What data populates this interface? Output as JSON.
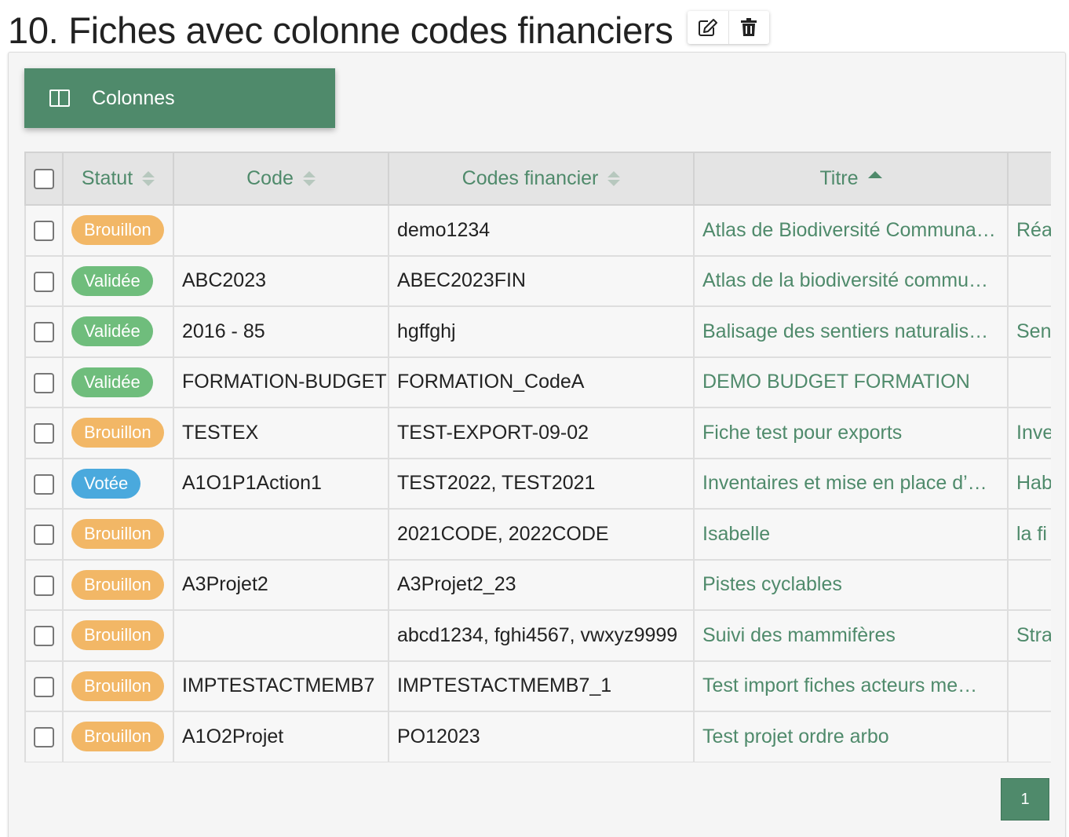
{
  "page": {
    "title": "10. Fiches avec colonne codes financiers",
    "actions": [
      {
        "name": "edit",
        "icon": "edit-icon"
      },
      {
        "name": "delete",
        "icon": "trash-icon"
      }
    ]
  },
  "toolbar": {
    "columns_label": "Colonnes",
    "columns_icon": "columns-icon"
  },
  "table": {
    "headers": {
      "statut": "Statut",
      "code": "Code",
      "codes_financier": "Codes financier",
      "titre": "Titre"
    },
    "sort": {
      "column": "Titre",
      "direction": "asc"
    },
    "rows": [
      {
        "statut": "Brouillon",
        "code": "",
        "codes_financier": "demo1234",
        "titre": "Atlas de Biodiversité Communa…",
        "extra": "Réa"
      },
      {
        "statut": "Validée",
        "code": "ABC2023",
        "codes_financier": "ABEC2023FIN",
        "titre": "Atlas de la biodiversité commu…",
        "extra": ""
      },
      {
        "statut": "Validée",
        "code": "2016 - 85",
        "codes_financier": "hgffghj",
        "titre": "Balisage des sentiers naturalis…",
        "extra": "Sen"
      },
      {
        "statut": "Validée",
        "code": "FORMATION-BUDGET",
        "codes_financier": "FORMATION_CodeA",
        "titre": "DEMO BUDGET FORMATION",
        "extra": ""
      },
      {
        "statut": "Brouillon",
        "code": "TESTEX",
        "codes_financier": "TEST-EXPORT-09-02",
        "titre": "Fiche test pour exports",
        "extra": "Inve"
      },
      {
        "statut": "Votée",
        "code": "A1O1P1Action1",
        "codes_financier": "TEST2022, TEST2021",
        "titre": "Inventaires et mise en place d’…",
        "extra": "Hab"
      },
      {
        "statut": "Brouillon",
        "code": "",
        "codes_financier": "2021CODE, 2022CODE",
        "titre": "Isabelle",
        "extra": "la fi"
      },
      {
        "statut": "Brouillon",
        "code": "A3Projet2",
        "codes_financier": "A3Projet2_23",
        "titre": "Pistes cyclables",
        "extra": ""
      },
      {
        "statut": "Brouillon",
        "code": "",
        "codes_financier": "abcd1234, fghi4567, vwxyz9999",
        "titre": "Suivi des mammifères",
        "extra": "Stra"
      },
      {
        "statut": "Brouillon",
        "code": "IMPTESTACTMEMB7",
        "codes_financier": "IMPTESTACTMEMB7_1",
        "titre": "Test import fiches acteurs me…",
        "extra": ""
      },
      {
        "statut": "Brouillon",
        "code": "A1O2Projet",
        "codes_financier": "PO12023",
        "titre": "Test projet ordre arbo",
        "extra": ""
      }
    ]
  },
  "status_colors": {
    "Brouillon": "#f2b766",
    "Validée": "#6fbd7c",
    "Votée": "#4aa9dd"
  },
  "colors": {
    "accent": "#4f8a6b"
  },
  "pagination": {
    "current_page": "1"
  }
}
